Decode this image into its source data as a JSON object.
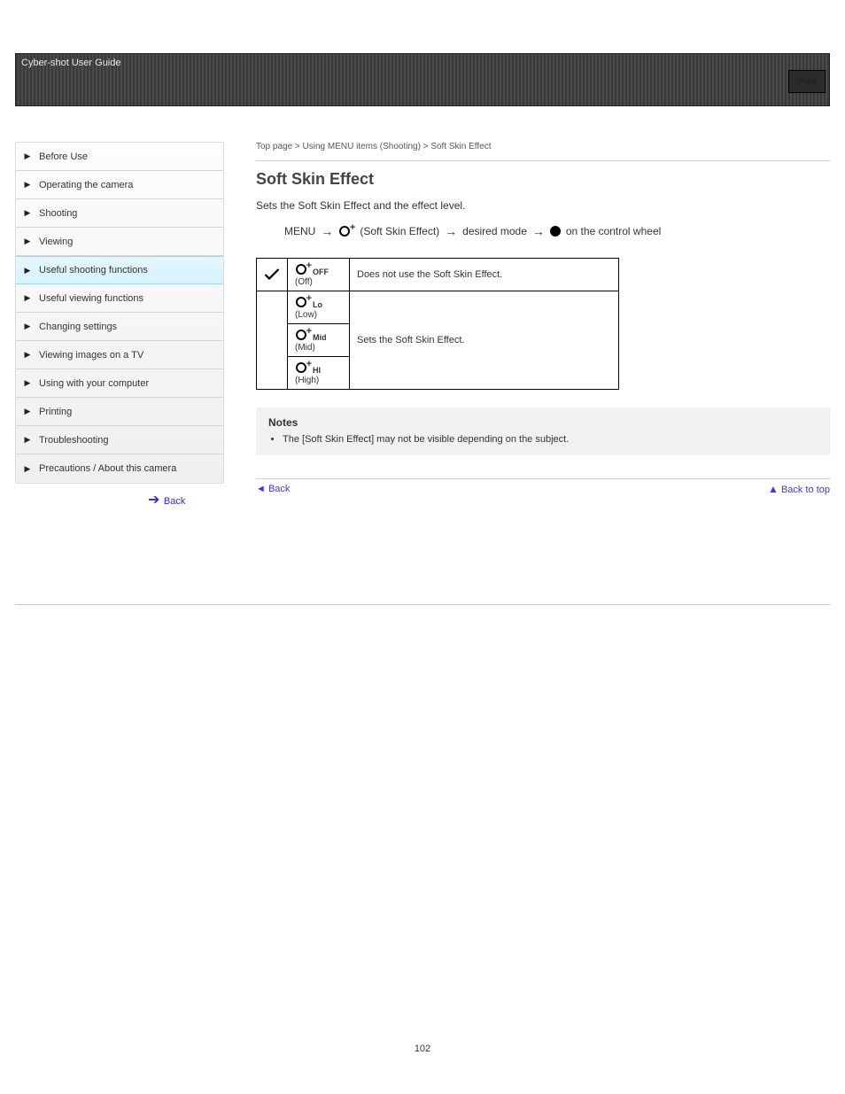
{
  "header": {
    "title": "Cyber-shot User Guide",
    "print_label": "Print"
  },
  "breadcrumb": "Top page > Using MENU items (Shooting) > Soft Skin Effect",
  "section": {
    "title": "Soft Skin Effect",
    "desc": "Sets the Soft Skin Effect and the effect level."
  },
  "path": {
    "step1": "MENU",
    "step2": "(Soft Skin Effect)",
    "step3": "desired mode",
    "step4": " on the control wheel"
  },
  "options": [
    {
      "sub": "OFF",
      "label": "(Off)",
      "desc": "Does not use the Soft Skin Effect.",
      "checked": true
    },
    {
      "sub": "Lo",
      "label": "(Low)",
      "desc": "Sets the Soft Skin Effect.",
      "checked": false
    },
    {
      "sub": "Mid",
      "label": "(Mid)",
      "desc": "",
      "checked": false
    },
    {
      "sub": "HI",
      "label": "(High)",
      "desc": "",
      "checked": false
    }
  ],
  "note": {
    "heading": "Notes",
    "items": [
      "The [Soft Skin Effect] may not be visible depending on the subject."
    ]
  },
  "sidebar": {
    "items": [
      "Before Use",
      "Operating the camera",
      "Shooting",
      "Viewing",
      "Useful shooting functions",
      "Useful viewing functions",
      "Changing settings",
      "Viewing images on a TV",
      "Using with your computer",
      "Printing",
      "Troubleshooting",
      "Precautions / About this camera"
    ],
    "selected_index": 4,
    "back_label": "Back"
  },
  "footer": {
    "back_label": "Back",
    "top_label": "Back to top"
  },
  "page_number": "102"
}
